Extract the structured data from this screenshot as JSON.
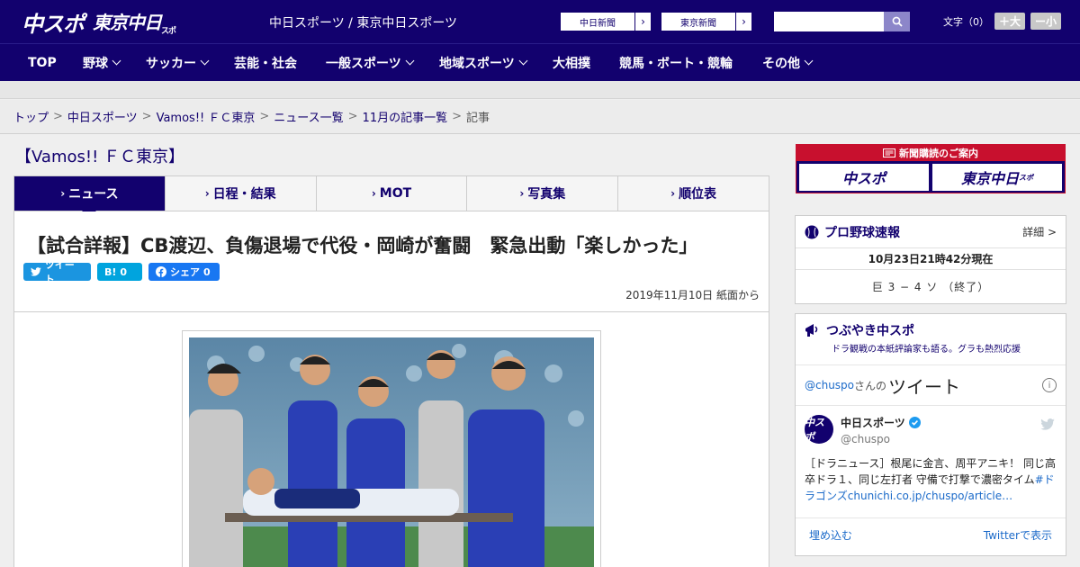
{
  "header": {
    "logo_chuspo": "中スポ",
    "logo_tokyo": "東京中日",
    "logo_tokyo_sub": "スポ",
    "site_name": "中日スポーツ / 東京中日スポーツ",
    "ext_links": [
      {
        "label": "中日新聞",
        "arrow": "›"
      },
      {
        "label": "東京新聞",
        "arrow": "›"
      }
    ],
    "search_placeholder": "",
    "font_label": "文字（0）",
    "font_up": "＋大",
    "font_down": "ー小"
  },
  "nav": {
    "items": [
      {
        "label": "TOP"
      },
      {
        "label": "野球"
      },
      {
        "label": "サッカー"
      },
      {
        "label": "芸能・社会"
      },
      {
        "label": "一般スポーツ"
      },
      {
        "label": "地域スポーツ"
      },
      {
        "label": "大相撲"
      },
      {
        "label": "競馬・ボート・競輪"
      },
      {
        "label": "その他"
      }
    ]
  },
  "breadcrumb": {
    "items": [
      "トップ",
      "中日スポーツ",
      "Vamos!! ＦＣ東京",
      "ニュース一覧",
      "11月の記事一覧"
    ],
    "current": "記事",
    "sep": ">"
  },
  "section": {
    "title": "【Vamos!! ＦＣ東京】"
  },
  "tabs": [
    {
      "label": "ニュース",
      "active": true
    },
    {
      "label": "日程・結果"
    },
    {
      "label": "MOT"
    },
    {
      "label": "写真集"
    },
    {
      "label": "順位表"
    }
  ],
  "tab_marker": "›",
  "article": {
    "headline": "【試合詳報】CB渡辺、負傷退場で代役・岡崎が奮闘　緊急出動「楽しかった」",
    "share": {
      "tweet": "ツイート",
      "hatena": "B!",
      "hatena_count": "0",
      "facebook": "シェア",
      "facebook_count": "0"
    },
    "date": "2019年11月10日 紙面から"
  },
  "sidebar": {
    "promo": {
      "title": "新聞購読のご案内",
      "btn1": "中スポ",
      "btn2": "東京中日",
      "btn2_sub": "スポ"
    },
    "baseball": {
      "title": "プロ野球速報",
      "more": "詳細 >",
      "time": "10月23日21時42分現在",
      "score": "巨 3 − 4 ソ （終了）"
    },
    "tweets": {
      "title": "つぶやき中スポ",
      "subtitle": "ドラ観戦の本紙評論家も語る。グラも熱烈応援",
      "handle_prefix": "@chuspo",
      "handle_suffix": "さんの",
      "header_big": "ツイート",
      "info": "i",
      "avatar_text": "中スポ",
      "user_name": "中日スポーツ",
      "user_handle": "@chuspo",
      "text_main": "［ドラニュース］根尾に金言、周平アニキ！ 同じ高卒ドラ１、同じ左打者 守備で打撃で濃密タイム",
      "text_hash": "#ドラゴンズ",
      "text_link": "chunichi.co.jp/chuspo/article…",
      "embed": "埋め込む",
      "view_on": "Twitterで表示"
    }
  },
  "colors": {
    "brand": "#12016e",
    "promo_red": "#c8102e",
    "twitter": "#1b95e0",
    "facebook": "#1877f2"
  }
}
